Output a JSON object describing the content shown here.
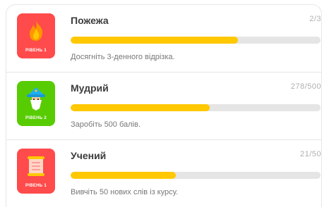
{
  "achievements": [
    {
      "title": "Пожежа",
      "count": "2/3",
      "progress": 0.67,
      "description": "Досягніть 3-денного відрізка.",
      "level_label": "РІВЕНЬ 1",
      "icon": "fire-icon",
      "color": "#ff4b4b"
    },
    {
      "title": "Мудрий",
      "count": "278/500",
      "progress": 0.556,
      "description": "Заробіть 500 балів.",
      "level_label": "РІВЕНЬ 2",
      "icon": "wizard-icon",
      "color": "#58cc02"
    },
    {
      "title": "Учений",
      "count": "21/50",
      "progress": 0.42,
      "description": "Вивчіть 50 нових слів із курсу.",
      "level_label": "РІВЕНЬ 1",
      "icon": "scroll-icon",
      "color": "#ff4b4b"
    }
  ],
  "colors": {
    "progress_fill": "#ffc800",
    "progress_track": "#e5e5e5"
  }
}
